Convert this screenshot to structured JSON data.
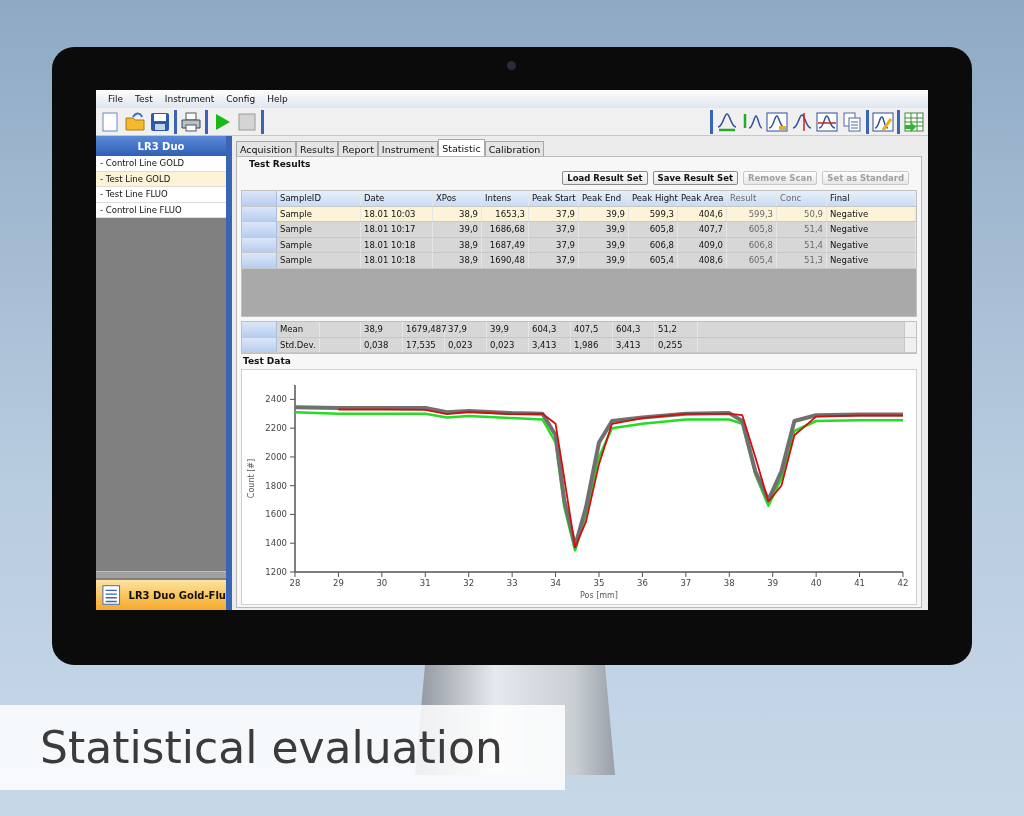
{
  "caption": "Statistical evaluation",
  "menu": [
    "File",
    "Test",
    "Instrument",
    "Config",
    "Help"
  ],
  "sidebar": {
    "title": "LR3 Duo",
    "items": [
      {
        "label": "- Control Line GOLD",
        "selected": false
      },
      {
        "label": "- Test Line GOLD",
        "selected": true
      },
      {
        "label": "- Test Line FLUO",
        "selected": false
      },
      {
        "label": "- Control Line FLUO",
        "selected": false
      }
    ],
    "footer": "LR3 Duo Gold-Flu"
  },
  "tabs": [
    {
      "label": "Acquisition",
      "selected": false
    },
    {
      "label": "Results",
      "selected": false
    },
    {
      "label": "Report",
      "selected": false
    },
    {
      "label": "Instrument",
      "selected": false
    },
    {
      "label": "Statistic",
      "selected": true
    },
    {
      "label": "Calibration",
      "selected": false
    }
  ],
  "test_results": {
    "title": "Test Results",
    "buttons": [
      {
        "label": "Load Result Set",
        "disabled": false
      },
      {
        "label": "Save Result Set",
        "disabled": false
      },
      {
        "label": "Remove Scan",
        "disabled": true
      },
      {
        "label": "Set as Standard",
        "disabled": true
      }
    ],
    "columns": [
      {
        "label": "SampleID",
        "disabled": false
      },
      {
        "label": "Date",
        "disabled": false
      },
      {
        "label": "XPos",
        "disabled": false
      },
      {
        "label": "Intens",
        "disabled": false
      },
      {
        "label": "Peak Start",
        "disabled": false
      },
      {
        "label": "Peak End",
        "disabled": false
      },
      {
        "label": "Peak Hight",
        "disabled": false
      },
      {
        "label": "Peak Area",
        "disabled": false
      },
      {
        "label": "Result",
        "disabled": true
      },
      {
        "label": "Conc",
        "disabled": true
      },
      {
        "label": "Final",
        "disabled": false
      }
    ],
    "rows": [
      {
        "selected": true,
        "cells": [
          "Sample",
          "18.01 10:03",
          "38,9",
          "1653,3",
          "37,9",
          "39,9",
          "599,3",
          "404,6",
          "599,3",
          "50,9",
          "Negative"
        ]
      },
      {
        "selected": false,
        "cells": [
          "Sample",
          "18.01 10:17",
          "39,0",
          "1686,68",
          "37,9",
          "39,9",
          "605,8",
          "407,7",
          "605,8",
          "51,4",
          "Negative"
        ]
      },
      {
        "selected": false,
        "cells": [
          "Sample",
          "18.01 10:18",
          "38,9",
          "1687,49",
          "37,9",
          "39,9",
          "606,8",
          "409,0",
          "606,8",
          "51,4",
          "Negative"
        ]
      },
      {
        "selected": false,
        "cells": [
          "Sample",
          "18.01 10:18",
          "38,9",
          "1690,48",
          "37,9",
          "39,9",
          "605,4",
          "408,6",
          "605,4",
          "51,3",
          "Negative"
        ]
      }
    ],
    "stats": [
      {
        "label": "Mean",
        "values": [
          "38,9",
          "1679,487",
          "37,9",
          "39,9",
          "604,3",
          "407,5",
          "604,3",
          "51,2"
        ]
      },
      {
        "label": "Std.Dev.",
        "values": [
          "0,038",
          "17,535",
          "0,023",
          "0,023",
          "3,413",
          "1,986",
          "3,413",
          "0,255"
        ]
      }
    ]
  },
  "test_data": {
    "title": "Test Data",
    "chart_data": {
      "type": "line",
      "xlabel": "Pos [mm]",
      "ylabel": "Count [#]",
      "x": [
        28,
        29,
        30,
        31,
        31.5,
        32,
        33,
        33.7,
        34,
        34.2,
        34.45,
        34.7,
        35,
        35.3,
        36,
        37,
        38,
        38.3,
        38.6,
        38.9,
        39.2,
        39.5,
        40,
        41,
        42
      ],
      "series": [
        {
          "color": "#22dd22",
          "values": [
            2310,
            2300,
            2300,
            2300,
            2275,
            2285,
            2270,
            2260,
            2100,
            1650,
            1350,
            1600,
            2000,
            2200,
            2230,
            2260,
            2260,
            2230,
            1880,
            1660,
            1850,
            2180,
            2250,
            2255,
            2255
          ]
        },
        {
          "color": "#707070",
          "values": [
            2345,
            2340,
            2340,
            2340,
            2310,
            2320,
            2305,
            2300,
            2150,
            1700,
            1380,
            1650,
            2100,
            2250,
            2275,
            2300,
            2305,
            2250,
            1900,
            1700,
            1900,
            2250,
            2290,
            2295,
            2295
          ]
        },
        {
          "color": "#d01010",
          "values": [
            null,
            2330,
            2330,
            2327,
            2298,
            2312,
            2298,
            2300,
            2230,
            1850,
            1370,
            1550,
            1950,
            2230,
            2270,
            2300,
            2300,
            2290,
            2000,
            1690,
            1800,
            2150,
            2280,
            2288,
            2288
          ]
        }
      ],
      "xlim": [
        28,
        42
      ],
      "ylim": [
        1200,
        2500
      ],
      "xticks": [
        28,
        29,
        30,
        31,
        32,
        33,
        34,
        35,
        36,
        37,
        38,
        39,
        40,
        41,
        42
      ],
      "yticks": [
        1200,
        1400,
        1600,
        1800,
        2000,
        2200,
        2400
      ]
    }
  }
}
